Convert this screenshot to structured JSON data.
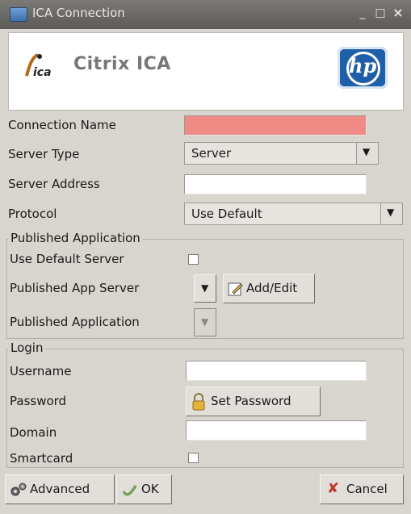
{
  "window": {
    "title": "ICA Connection",
    "controls": [
      "_",
      "□",
      "×"
    ]
  },
  "banner": {
    "title": "Citrix ICA",
    "hp_logo_text": "hp"
  },
  "form": {
    "connection_name": {
      "label": "Connection Name",
      "value": ""
    },
    "server_type": {
      "label": "Server Type",
      "value": "Server"
    },
    "server_address": {
      "label": "Server Address",
      "value": ""
    },
    "protocol": {
      "label": "Protocol",
      "value": "Use Default"
    }
  },
  "published": {
    "legend": "Published Application",
    "use_default_server": {
      "label": "Use Default Server",
      "checked": false
    },
    "app_server": {
      "label": "Published App Server",
      "add_edit": "Add/Edit"
    },
    "application": {
      "label": "Published Application"
    }
  },
  "login": {
    "legend": "Login",
    "username": {
      "label": "Username",
      "value": ""
    },
    "password": {
      "label": "Password",
      "button": "Set Password"
    },
    "domain": {
      "label": "Domain",
      "value": ""
    },
    "smartcard": {
      "label": "Smartcard",
      "checked": false
    }
  },
  "footer": {
    "advanced": "Advanced",
    "ok": "OK",
    "cancel": "Cancel"
  },
  "colors": {
    "required_field": "#f08a85",
    "titlebar": "#6b6966",
    "hp_blue": "#1f5ea8",
    "cancel_x": "#c0392b"
  },
  "icons": [
    "window-app-icon",
    "ica-logo-icon",
    "hp-logo-icon",
    "chevron-down-icon",
    "edit-pencil-icon",
    "lock-icon",
    "advanced-gears-icon",
    "ok-check-icon",
    "cancel-x-icon"
  ]
}
